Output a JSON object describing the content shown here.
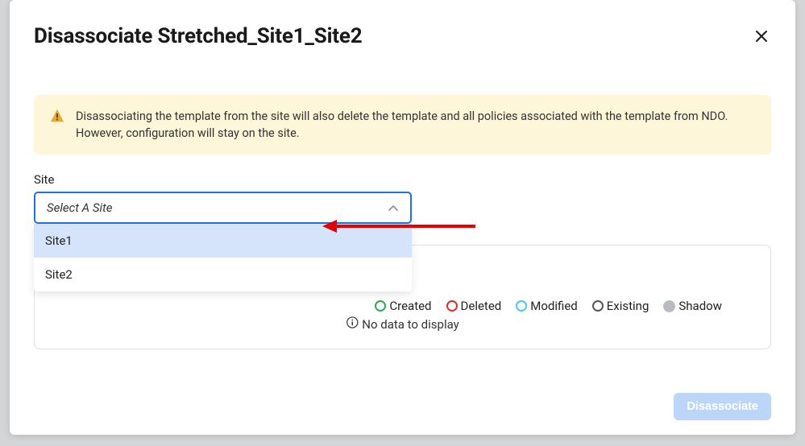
{
  "header": {
    "title": "Disassociate Stretched_Site1_Site2"
  },
  "warning": {
    "text": "Disassociating the template from the site will also delete the template and all policies associated with the template from NDO. However, configuration will stay on the site."
  },
  "site_field": {
    "label": "Site",
    "placeholder": "Select A Site",
    "options": [
      "Site1",
      "Site2"
    ]
  },
  "legend": {
    "created": "Created",
    "deleted": "Deleted",
    "modified": "Modified",
    "existing": "Existing",
    "shadow": "Shadow"
  },
  "nodata": "No data to display",
  "footer": {
    "disassociate": "Disassociate"
  }
}
